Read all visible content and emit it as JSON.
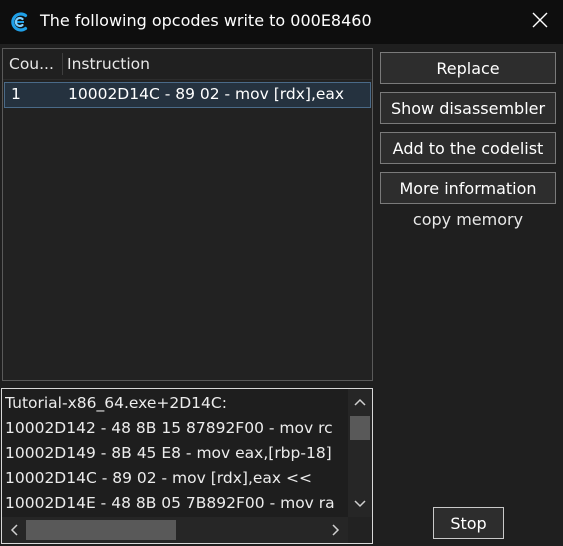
{
  "window": {
    "title": "The following opcodes write to 000E8460",
    "icon": "cheat-engine-icon",
    "close_icon": "close-icon"
  },
  "list": {
    "columns": [
      "Cou...",
      "Instruction"
    ],
    "rows": [
      {
        "count": "1",
        "instruction": "10002D14C - 89 02  - mov [rdx],eax"
      }
    ]
  },
  "buttons": {
    "replace": "Replace",
    "show_disassembler": "Show disassembler",
    "add_to_codelist": "Add to the codelist",
    "more_information": "More information",
    "copy_memory": "copy memory",
    "stop": "Stop"
  },
  "disassembly": {
    "lines": [
      "Tutorial-x86_64.exe+2D14C:",
      "10002D142 - 48 8B 15 87892F00  - mov rc",
      "10002D149 - 8B 45 E8  - mov eax,[rbp-18]",
      "10002D14C - 89 02  - mov [rdx],eax <<",
      "10002D14E - 48 8B 05 7B892F00  - mov ra"
    ]
  },
  "colors": {
    "background": "#1f1f1f",
    "titlebar": "#0e0e0e",
    "selection": "#25323f",
    "accent": "#1fa0e8"
  }
}
